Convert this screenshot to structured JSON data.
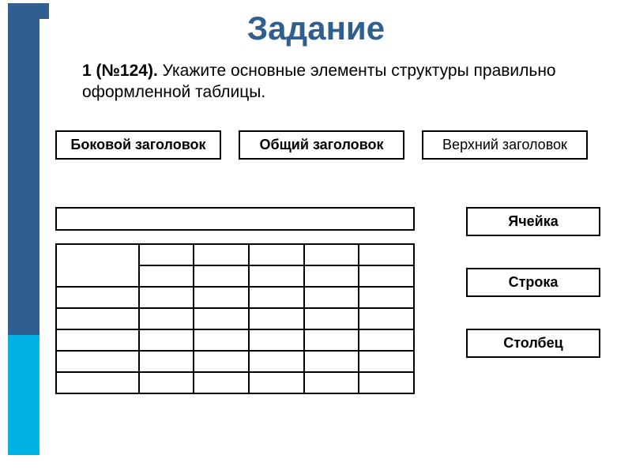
{
  "title": "Задание",
  "task": {
    "prefix": "1 (№124).",
    "body": "Укажите основные элементы структуры правильно оформленной таблицы."
  },
  "top_labels": {
    "side_header": "Боковой заголовок",
    "general_header": "Общий заголовок",
    "top_header": "Верхний заголовок"
  },
  "right_labels": {
    "cell": "Ячейка",
    "row": "Строка",
    "column": "Столбец"
  }
}
